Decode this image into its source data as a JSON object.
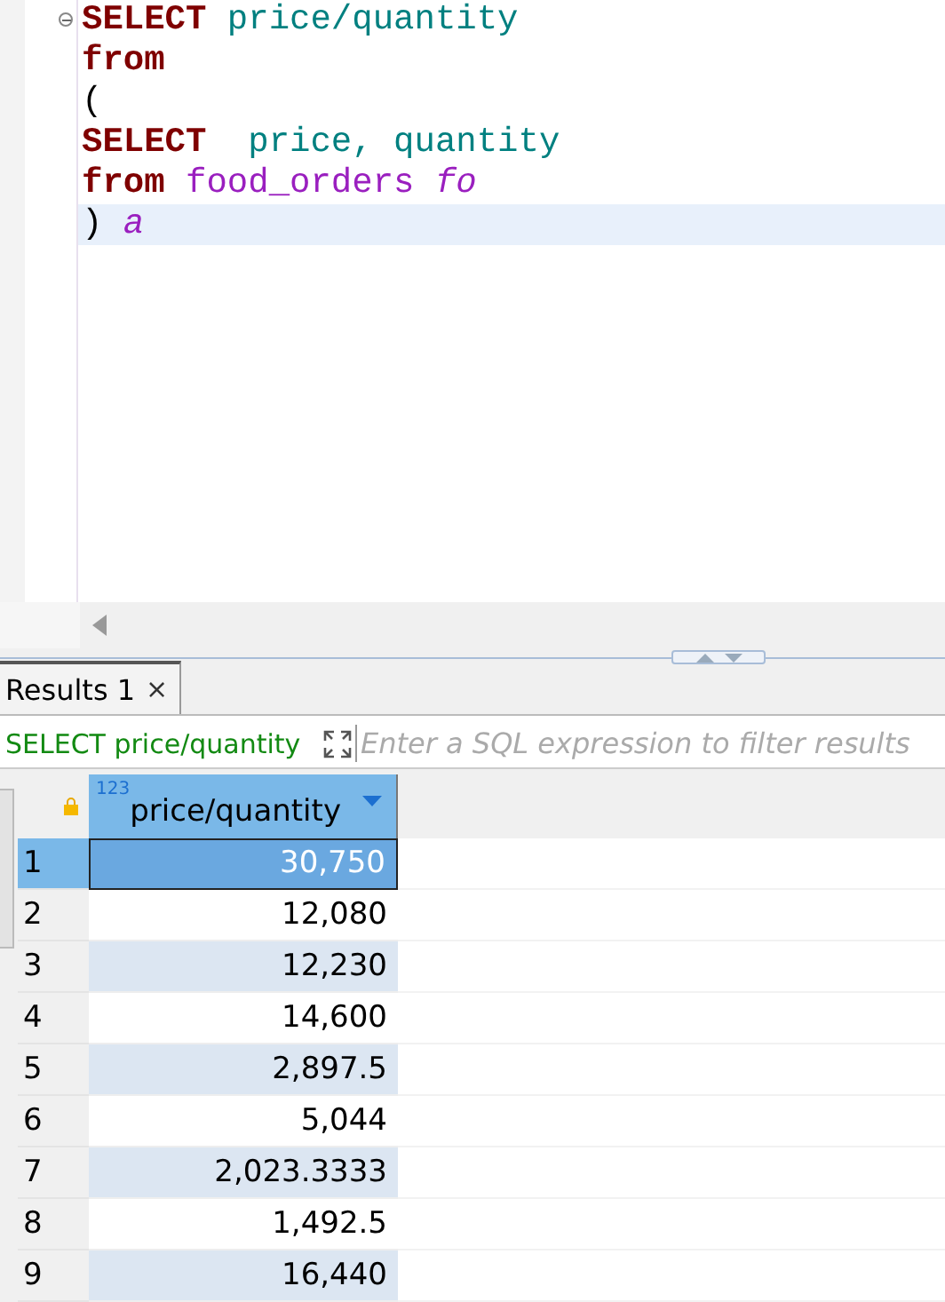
{
  "editor": {
    "lines": [
      {
        "current": false,
        "fold": true,
        "tokens": [
          {
            "kind": "keyword",
            "text": "SELECT"
          },
          {
            "kind": "column",
            "text": " price/quantity"
          }
        ]
      },
      {
        "current": false,
        "fold": false,
        "tokens": [
          {
            "kind": "keyword",
            "text": "from"
          }
        ]
      },
      {
        "current": false,
        "fold": false,
        "tokens": [
          {
            "kind": "plain",
            "text": "("
          }
        ]
      },
      {
        "current": false,
        "fold": false,
        "tokens": [
          {
            "kind": "keyword",
            "text": "SELECT"
          },
          {
            "kind": "column",
            "text": "  price, quantity"
          }
        ]
      },
      {
        "current": false,
        "fold": false,
        "tokens": [
          {
            "kind": "keyword",
            "text": "from"
          },
          {
            "kind": "table",
            "text": " food_orders"
          },
          {
            "kind": "alias",
            "text": " fo"
          }
        ]
      },
      {
        "current": true,
        "fold": false,
        "tokens": [
          {
            "kind": "plain",
            "text": ")"
          },
          {
            "kind": "alias",
            "text": " a"
          }
        ]
      }
    ]
  },
  "results": {
    "tabs": [
      {
        "label": "Results 1",
        "close": "×",
        "selected": true
      }
    ],
    "filter": {
      "query": "SELECT price/quantity",
      "placeholder": "Enter a SQL expression to filter results"
    },
    "table": {
      "column": {
        "type": "123",
        "name": "price/quantity"
      },
      "rows": [
        {
          "num": "1",
          "value": "30,750",
          "selected": true
        },
        {
          "num": "2",
          "value": "12,080",
          "selected": false
        },
        {
          "num": "3",
          "value": "12,230",
          "selected": false
        },
        {
          "num": "4",
          "value": "14,600",
          "selected": false
        },
        {
          "num": "5",
          "value": "2,897.5",
          "selected": false
        },
        {
          "num": "6",
          "value": "5,044",
          "selected": false
        },
        {
          "num": "7",
          "value": "2,023.3333",
          "selected": false
        },
        {
          "num": "8",
          "value": "1,492.5",
          "selected": false
        },
        {
          "num": "9",
          "value": "16,440",
          "selected": false
        }
      ]
    }
  }
}
